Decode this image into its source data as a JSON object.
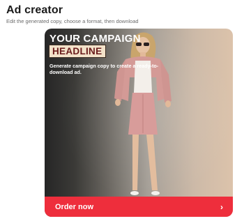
{
  "page": {
    "title": "Ad creator",
    "subtitle": "Edit the generated copy, choose a format, then download"
  },
  "ad": {
    "headline_line1": "YOUR CAMPAIGN",
    "headline_line2": "HEADLINE",
    "body": "Generate campaign copy to create a ready-to-download ad.",
    "cta_label": "Order now",
    "cta_icon": "chevron-right-icon",
    "image": "model-photo (woman in pink denim jacket and skirt, white top, sunglasses)",
    "colors": {
      "cta": "#ee2e3c",
      "headline_highlight_bg": "#f3e2c9",
      "headline_highlight_text": "#6a1b1b"
    }
  }
}
